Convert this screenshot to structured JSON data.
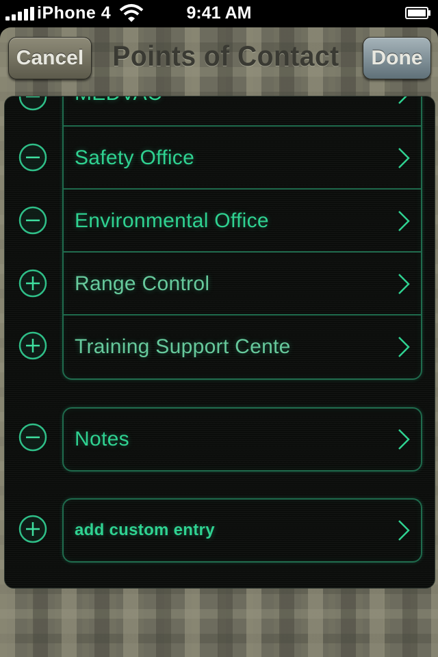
{
  "status_bar": {
    "carrier": "iPhone 4",
    "time": "9:41 AM",
    "signal_icon": "signal-bars-icon",
    "wifi_icon": "wifi-icon",
    "battery_icon": "battery-icon"
  },
  "nav": {
    "title": "Points of Contact",
    "cancel_label": "Cancel",
    "done_label": "Done"
  },
  "contacts": [
    {
      "label": "MEDVAC",
      "action": "remove"
    },
    {
      "label": "Safety Office",
      "action": "remove"
    },
    {
      "label": "Environmental Office",
      "action": "remove"
    },
    {
      "label": "Range Control",
      "action": "add"
    },
    {
      "label": "Training Support Cente",
      "action": "add"
    }
  ],
  "notes": {
    "label": "Notes",
    "action": "remove"
  },
  "custom": {
    "label": "add custom entry",
    "action": "add"
  },
  "colors": {
    "accent": "#2fd291",
    "border": "#1f6b4d",
    "panel": "#0b0d0b"
  }
}
